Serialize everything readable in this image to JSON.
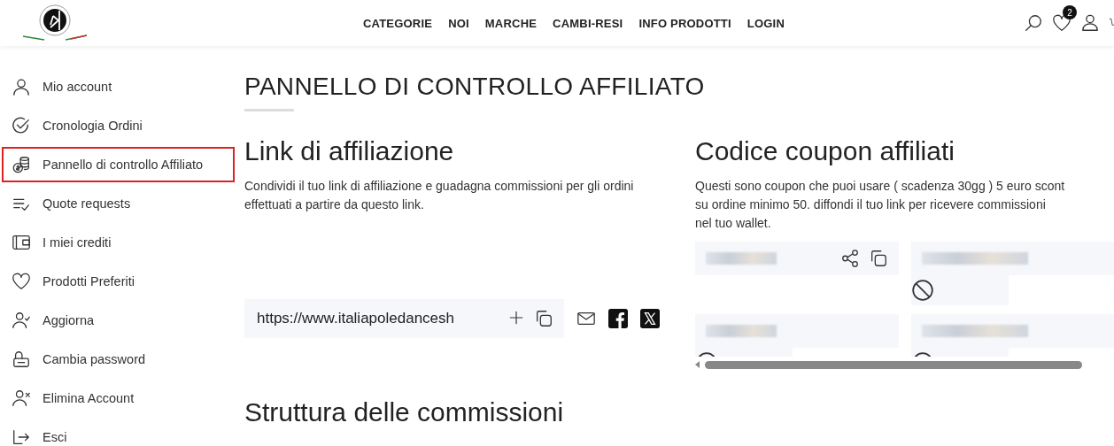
{
  "header": {
    "nav": [
      {
        "label": "CATEGORIE"
      },
      {
        "label": "NOI"
      },
      {
        "label": "MARCHE"
      },
      {
        "label": "CAMBI-RESI"
      },
      {
        "label": "INFO PRODOTTI"
      },
      {
        "label": "LOGIN"
      }
    ],
    "wishlist_count": "2"
  },
  "sidebar": {
    "items": [
      {
        "label": "Mio account",
        "kind": "user",
        "selected": false
      },
      {
        "label": "Cronologia Ordini",
        "kind": "check",
        "selected": false
      },
      {
        "label": "Pannello di controllo Affiliato",
        "kind": "coins",
        "selected": true
      },
      {
        "label": "Quote requests",
        "kind": "list",
        "selected": false
      },
      {
        "label": "I miei crediti",
        "kind": "wallet",
        "selected": false
      },
      {
        "label": "Prodotti Preferiti",
        "kind": "heart",
        "selected": false
      },
      {
        "label": "Aggiorna",
        "kind": "user-check",
        "selected": false
      },
      {
        "label": "Cambia password",
        "kind": "lock",
        "selected": false
      },
      {
        "label": "Elimina Account",
        "kind": "user-x",
        "selected": false
      },
      {
        "label": "Esci",
        "kind": "logout",
        "selected": false
      }
    ]
  },
  "page_title": "PANNELLO DI CONTROLLO AFFILIATO",
  "affiliate_link": {
    "title": "Link di affiliazione",
    "description": "Condividi il tuo link di affiliazione e guadagna commissioni per gli ordini effettuati a partire da questo link.",
    "value": "https://www.italiapoledancesh"
  },
  "coupons": {
    "title": "Codice coupon affiliati",
    "description_lines": [
      "Questi sono coupon che puoi usare ( scadenza 30gg ) 5 euro scont",
      "su ordine minimo 50. diffondi il tuo link per ricevere commissioni",
      "nel tuo wallet."
    ],
    "items": [
      {
        "active": true
      },
      {
        "active": false
      },
      {
        "active": false
      },
      {
        "active": false
      }
    ]
  },
  "commission_title": "Struttura delle commissioni"
}
